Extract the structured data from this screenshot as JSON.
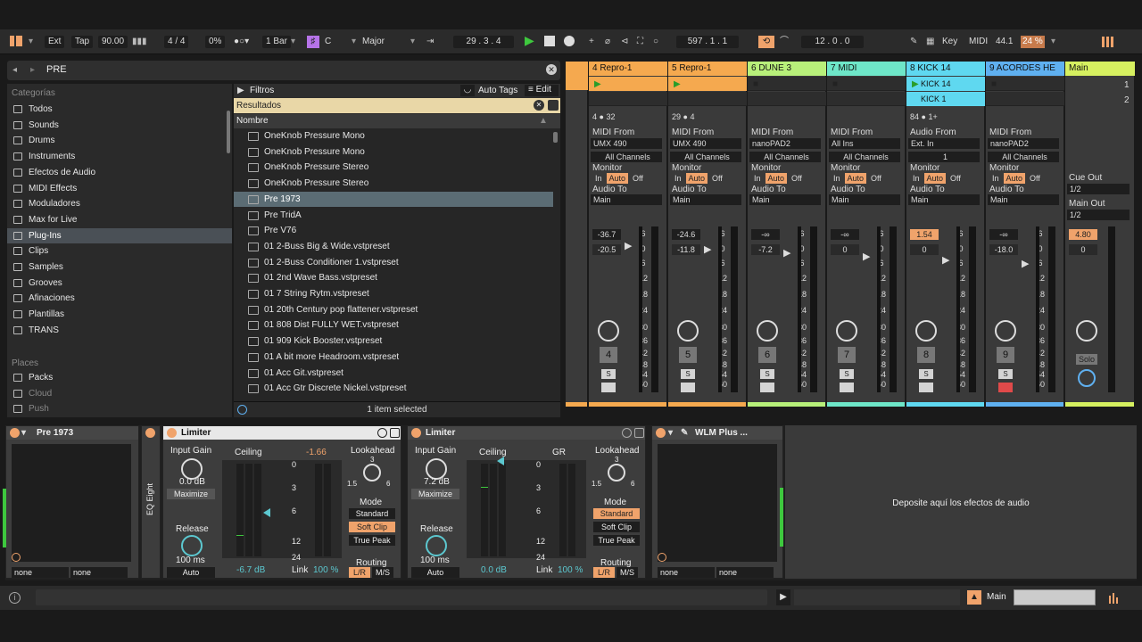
{
  "topbar": {
    "ext": "Ext",
    "tap": "Tap",
    "tempo": "90.00",
    "sig_num": "4",
    "sig_sep": "/",
    "sig_den": "4",
    "swing": "0%",
    "quantize": "1 Bar",
    "key": "C",
    "scale": "Major",
    "arr_pos": "29 . 3 . 4",
    "loop_start": "597 . 1 . 1",
    "loop_len": "12 . 0 . 0",
    "key_map": "Key",
    "midi_map": "MIDI",
    "sample_rate": "44.1",
    "cpu": "24 %"
  },
  "browser": {
    "search_value": "PRE",
    "categories_header": "Categorías",
    "categories": [
      "Todos",
      "Sounds",
      "Drums",
      "Instruments",
      "Efectos de Audio",
      "MIDI Effects",
      "Moduladores",
      "Max for Live",
      "Plug-Ins",
      "Clips",
      "Samples",
      "Grooves",
      "Afinaciones",
      "Plantillas",
      "TRANS"
    ],
    "places_header": "Places",
    "places": [
      "Packs",
      "Cloud",
      "Push"
    ],
    "filters_label": "Filtros",
    "auto_tags_label": "Auto Tags",
    "edit_label": "Edit",
    "results_label": "Resultados",
    "name_column": "Nombre",
    "items": [
      "OneKnob Pressure Mono",
      "OneKnob Pressure Mono",
      "OneKnob Pressure Stereo",
      "OneKnob Pressure Stereo",
      "Pre 1973",
      "Pre TridA",
      "Pre V76",
      "01 2-Buss Big & Wide.vstpreset",
      "01 2-Buss Conditioner 1.vstpreset",
      "01 2nd Wave Bass.vstpreset",
      "01 7 String Rytm.vstpreset",
      "01 20th Century pop flattener.vstpreset",
      "01 808 Dist FULLY WET.vstpreset",
      "01 909 Kick Booster.vstpreset",
      "01 A bit more Headroom.vstpreset",
      "01 Acc Git.vstpreset",
      "01 Acc Gtr Discrete Nickel.vstpreset"
    ],
    "selected_index": 4,
    "status": "1 item selected"
  },
  "tracks": [
    {
      "name": "4 Repro-1",
      "color": "#f5a94f",
      "num": "4",
      "from_label": "MIDI From",
      "from": "UMX 490",
      "ch": "All Channels",
      "to": "Main",
      "vol": "-36.7",
      "peak": "-20.5",
      "clip": "",
      "lane": "4 ● 32"
    },
    {
      "name": "5 Repro-1",
      "color": "#f5a94f",
      "num": "5",
      "from_label": "MIDI From",
      "from": "UMX 490",
      "ch": "All Channels",
      "to": "Main",
      "vol": "-24.6",
      "peak": "-11.8",
      "clip": "",
      "lane": "29 ● 4"
    },
    {
      "name": "6 DUNE 3",
      "color": "#b8f07a",
      "num": "6",
      "from_label": "MIDI From",
      "from": "nanoPAD2",
      "ch": "All Channels",
      "to": "Main",
      "vol": "-∞",
      "peak": "-7.2",
      "clip": "",
      "lane": ""
    },
    {
      "name": "7 MIDI",
      "color": "#6ee6c8",
      "num": "7",
      "from_label": "MIDI From",
      "from": "All Ins",
      "ch": "All Channels",
      "to": "Main",
      "vol": "-∞",
      "peak": "0",
      "clip": "",
      "lane": ""
    },
    {
      "name": "8 KICK 14",
      "color": "#5fd8f0",
      "num": "8",
      "from_label": "Audio From",
      "from": "Ext. In",
      "ch": "1",
      "to": "Main",
      "vol": "1.54",
      "peak": "0",
      "clip": "KICK 14",
      "clip2": "KICK 1",
      "lane": "84 ● 1+"
    },
    {
      "name": "9 ACORDES HE",
      "color": "#5fb0f0",
      "num": "9",
      "from_label": "MIDI From",
      "from": "nanoPAD2",
      "ch": "All Channels",
      "to": "Main",
      "vol": "-∞",
      "peak": "-18.0",
      "clip": "",
      "lane": ""
    }
  ],
  "main_track": {
    "name": "Main",
    "color": "#d6f060",
    "scene1": "1",
    "scene2": "2",
    "cue_out_label": "Cue Out",
    "cue_out": "1/2",
    "main_out_label": "Main Out",
    "main_out": "1/2",
    "vol": "4.80",
    "peak": "0",
    "solo": "Solo"
  },
  "io": {
    "monitor": "Monitor",
    "in": "In",
    "auto": "Auto",
    "off": "Off",
    "audio_to": "Audio To"
  },
  "fader_scale": [
    "6",
    "0",
    "6",
    "12",
    "18",
    "24",
    "30",
    "36",
    "42",
    "48",
    "54",
    "60"
  ],
  "devices": {
    "pre1973": {
      "title": "Pre 1973",
      "sel1": "none",
      "sel2": "none"
    },
    "eq_eight": {
      "title": "EQ Eight"
    },
    "limiter1": {
      "title": "Limiter",
      "input_gain_label": "Input Gain",
      "input_gain": "0.0 dB",
      "maximize": "Maximize",
      "ceiling_label": "Ceiling",
      "ceiling_gr": "-1.66",
      "lookahead_label": "Lookahead",
      "lookahead_val": "3",
      "la_min": "1.5",
      "la_max": "6",
      "release_label": "Release",
      "release": "100 ms",
      "auto": "Auto",
      "ceiling": "-6.7 dB",
      "link_label": "Link",
      "link": "100 %",
      "mode_label": "Mode",
      "modes": [
        "Standard",
        "Soft Clip",
        "True Peak"
      ],
      "routing_label": "Routing",
      "lr": "L/R",
      "ms": "M/S",
      "scale": [
        "0",
        "3",
        "6",
        "12",
        "24"
      ]
    },
    "limiter2": {
      "title": "Limiter",
      "input_gain_label": "Input Gain",
      "input_gain": "7.2 dB",
      "maximize": "Maximize",
      "ceiling_label": "Ceiling",
      "gr_label": "GR",
      "lookahead_label": "Lookahead",
      "lookahead_val": "3",
      "la_min": "1.5",
      "la_max": "6",
      "release_label": "Release",
      "release": "100 ms",
      "auto": "Auto",
      "ceiling": "0.0 dB",
      "link_label": "Link",
      "link": "100 %",
      "mode_label": "Mode",
      "modes": [
        "Standard",
        "Soft Clip",
        "True Peak"
      ],
      "routing_label": "Routing",
      "lr": "L/R",
      "ms": "M/S",
      "scale": [
        "0",
        "3",
        "6",
        "12",
        "24"
      ]
    },
    "wlm": {
      "title": "WLM Plus ...",
      "sel1": "none",
      "sel2": "none"
    },
    "drop_text": "Deposite aquí los efectos de audio"
  },
  "statusbar": {
    "main_label": "Main"
  }
}
